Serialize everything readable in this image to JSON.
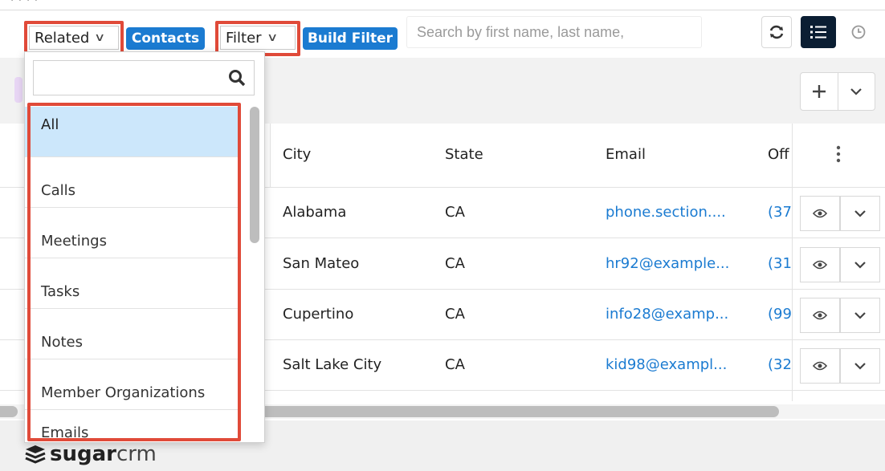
{
  "filterbar": {
    "related_label": "Related",
    "module_label": "Contacts",
    "filter_label": "Filter",
    "build_filter_label": "Build Filter",
    "search_placeholder": "Search by first name, last name,"
  },
  "icons": {
    "refresh": "refresh-icon",
    "list_view": "list-view-icon",
    "activity_stream": "clock-icon",
    "add": "plus-icon",
    "more": "chevron-down-icon",
    "search": "search-icon",
    "row_preview": "eye-icon",
    "row_actions": "chevron-down-icon",
    "column_menu": "vertical-dots-icon"
  },
  "table": {
    "headers": [
      "City",
      "State",
      "Email",
      "Off"
    ],
    "rows": [
      {
        "city": "Alabama",
        "state": "CA",
        "email": "phone.section....",
        "office": "(37"
      },
      {
        "city": "San Mateo",
        "state": "CA",
        "email": "hr92@example...",
        "office": "(31"
      },
      {
        "city": "Cupertino",
        "state": "CA",
        "email": "info28@examp...",
        "office": "(99"
      },
      {
        "city": "Salt Lake City",
        "state": "CA",
        "email": "kid98@exampl...",
        "office": "(32"
      }
    ]
  },
  "related_dropdown": {
    "items": [
      "All",
      "Calls",
      "Meetings",
      "Tasks",
      "Notes",
      "Member Organizations",
      "Emails"
    ],
    "selected": "All"
  },
  "footer": {
    "brand_bold": "sugar",
    "brand_light": "crm"
  },
  "colors": {
    "accent": "#1b7bd1",
    "highlight": "#e04a39",
    "selected_item": "#cce7fb",
    "dark_toggle": "#0b1e33"
  }
}
